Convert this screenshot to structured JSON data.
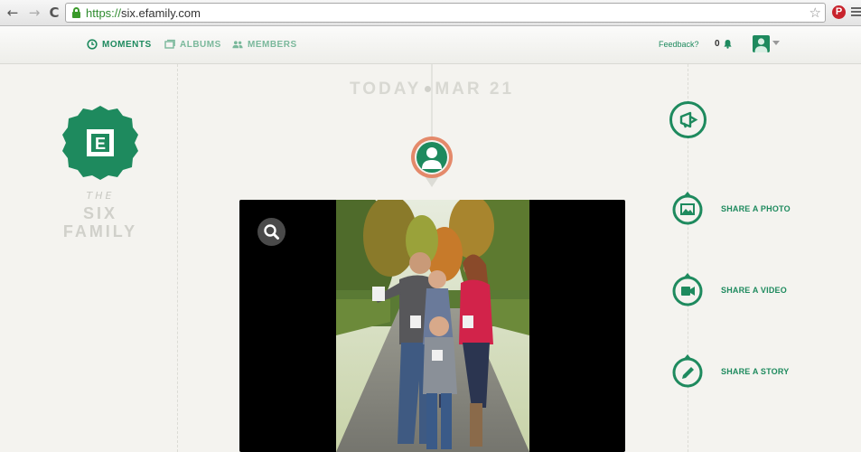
{
  "browser": {
    "url_scheme": "https://",
    "url_host": "six.efamily.com",
    "back_glyph": "←",
    "forward_glyph": "→",
    "reload_glyph": "C",
    "star_glyph": "☆",
    "pinterest_glyph": "P"
  },
  "nav": {
    "moments": "MOMENTS",
    "albums": "ALBUMS",
    "members": "MEMBERS",
    "feedback": "Feedback?",
    "notifications_count": "0"
  },
  "brand": {
    "logo_letter": "E",
    "the": "THE",
    "line1": "SIX",
    "line2": "FAMILY"
  },
  "timeline": {
    "today": "TODAY",
    "date": "MAR 21"
  },
  "actions": {
    "share_photo": "SHARE A PHOTO",
    "share_video": "SHARE A VIDEO",
    "share_story": "SHARE A STORY"
  },
  "colors": {
    "accent": "#1e8a5e",
    "accent_light": "#7ab89b",
    "avatar_ring": "#e4896a",
    "background": "#f4f3ef"
  },
  "icons": [
    "back-icon",
    "forward-icon",
    "reload-icon",
    "lock-icon",
    "star-icon",
    "pinterest-icon",
    "menu-icon",
    "clock-icon",
    "albums-icon",
    "members-icon",
    "bell-icon",
    "user-icon",
    "megaphone-icon",
    "photo-icon",
    "video-icon",
    "pencil-icon",
    "search-icon"
  ]
}
